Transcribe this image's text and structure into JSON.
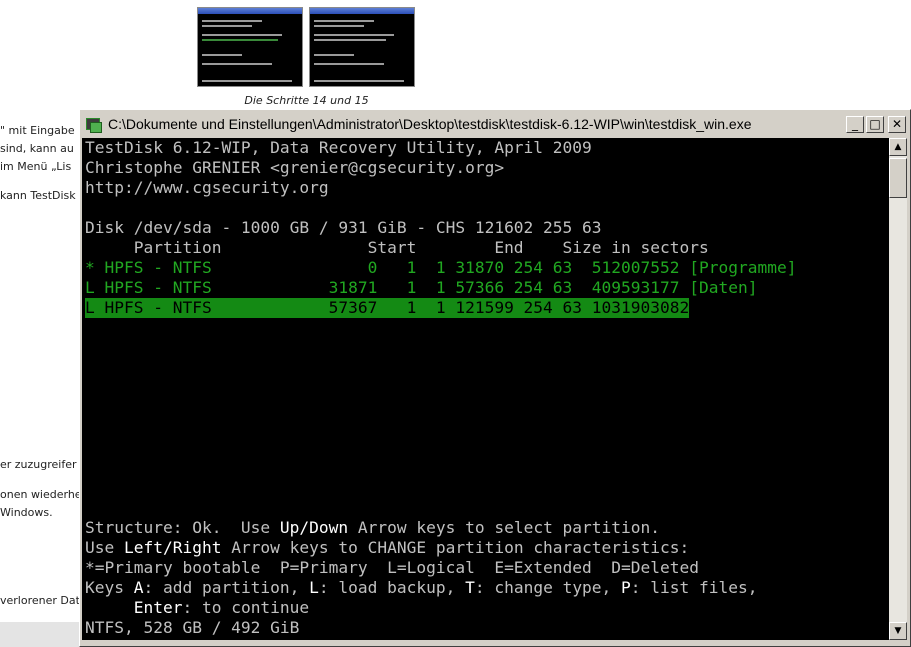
{
  "background_page": {
    "caption": "Die Schritte 14 und 15",
    "fragments": [
      "\" mit Eingabe",
      "sind, kann au",
      "im Menü „Lis",
      "kann TestDisk",
      "er zuzugreifer",
      "onen wiederhe",
      "Windows.",
      "verlorener Dat"
    ]
  },
  "window": {
    "title": "C:\\Dokumente und Einstellungen\\Administrator\\Desktop\\testdisk\\testdisk-6.12-WIP\\win\\testdisk_win.exe",
    "buttons": {
      "minimize": "_",
      "maximize": "□",
      "close": "✕"
    },
    "icon": "console-app-icon"
  },
  "console": {
    "header": [
      "TestDisk 6.12-WIP, Data Recovery Utility, April 2009",
      "Christophe GRENIER <grenier@cgsecurity.org>",
      "http://www.cgsecurity.org"
    ],
    "disk_line": "Disk /dev/sda - 1000 GB / 931 GiB - CHS 121602 255 63",
    "table_header": "     Partition               Start        End    Size in sectors",
    "partitions": [
      "* HPFS - NTFS                0   1  1 31870 254 63  512007552 [Programme]",
      "L HPFS - NTFS            31871   1  1 57366 254 63  409593177 [Daten]",
      "L HPFS - NTFS            57367   1  1 121599 254 63 1031903082"
    ],
    "help": {
      "line1_a": "Structure: Ok.  Use ",
      "line1_b": "Up/Down",
      "line1_c": " Arrow keys to select partition.",
      "line2_a": "Use ",
      "line2_b": "Left/Right",
      "line2_c": " Arrow keys to CHANGE partition characteristics:",
      "line3": "*=Primary bootable  P=Primary  L=Logical  E=Extended  D=Deleted",
      "line4_a": "Keys ",
      "line4_b": "A",
      "line4_c": ": add partition, ",
      "line4_d": "L",
      "line4_e": ": load backup, ",
      "line4_f": "T",
      "line4_g": ": change type, ",
      "line4_h": "P",
      "line4_i": ": list files,",
      "line5_a": "     ",
      "line5_b": "Enter",
      "line5_c": ": to continue"
    },
    "status": "NTFS, 528 GB / 492 GiB"
  },
  "colors": {
    "console_bg": "#000000",
    "console_text": "#c0c0c0",
    "partition_green": "#21a821",
    "selection_bg": "#148a14"
  }
}
